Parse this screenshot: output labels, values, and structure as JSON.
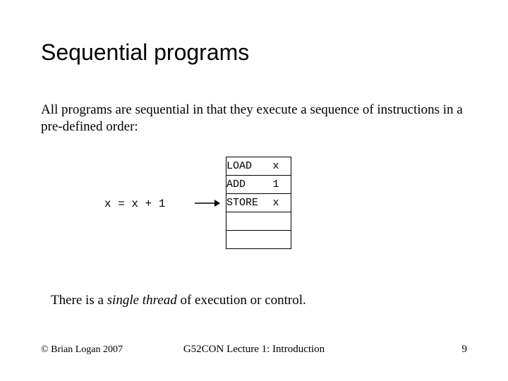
{
  "title": "Sequential programs",
  "paragraph": "All programs are sequential in that they execute a sequence of instructions in a pre-defined order:",
  "expr": "x = x + 1",
  "instructions": {
    "rows": [
      {
        "op": "LOAD",
        "arg": "x"
      },
      {
        "op": "ADD",
        "arg": "1"
      },
      {
        "op": "STORE",
        "arg": "x"
      },
      {
        "op": "",
        "arg": ""
      },
      {
        "op": "",
        "arg": ""
      }
    ]
  },
  "closing": {
    "pre": "There is a ",
    "em": "single thread",
    "post": " of execution or control."
  },
  "footer": {
    "left": "© Brian Logan 2007",
    "center": "G52CON Lecture 1: Introduction",
    "right": "9"
  }
}
